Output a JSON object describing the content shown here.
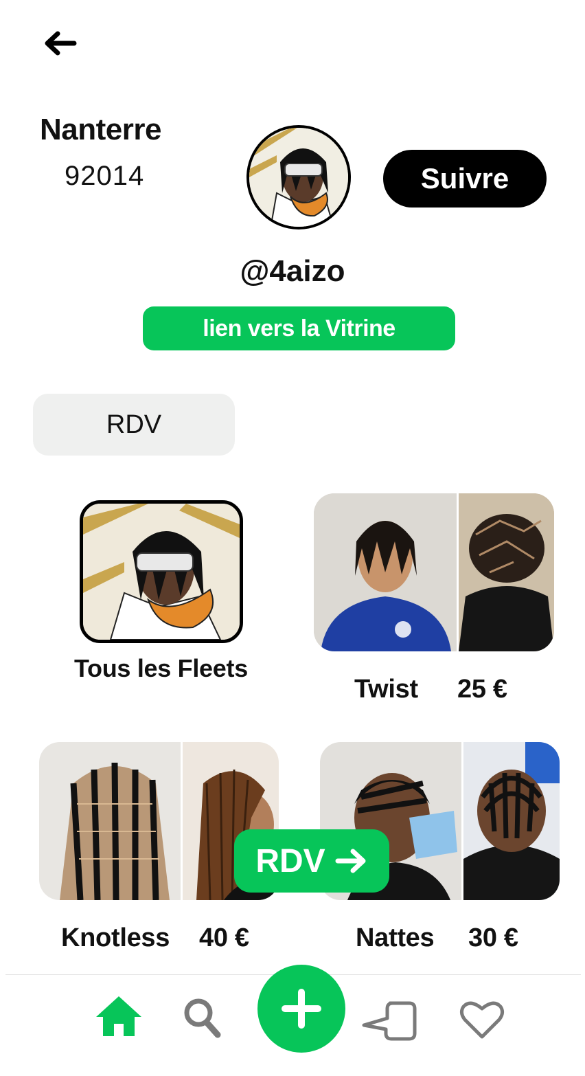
{
  "header": {
    "back_icon": "arrow-left-icon",
    "city": "Nanterre",
    "zip": "92014",
    "follow_label": "Suivre"
  },
  "profile": {
    "handle": "@4aizo",
    "vitrine_label": "lien vers la Vitrine"
  },
  "tabs": {
    "rdv_label": "RDV"
  },
  "fleets": {
    "label": "Tous les Fleets"
  },
  "services": [
    {
      "name": "Twist",
      "price": "25 €"
    },
    {
      "name": "Knotless",
      "price": "40 €"
    },
    {
      "name": "Nattes",
      "price": "30 €"
    }
  ],
  "floating": {
    "rdv_label": "RDV",
    "icon": "arrow-right-icon"
  },
  "navbar": {
    "items": [
      "home-icon",
      "search-icon",
      "plus-icon",
      "chat-icon",
      "heart-icon"
    ],
    "active": "home-icon"
  },
  "colors": {
    "accent": "#07c559",
    "black": "#000000",
    "tab_bg": "#eff0ef",
    "inactive_icon": "#7a7a7a"
  }
}
